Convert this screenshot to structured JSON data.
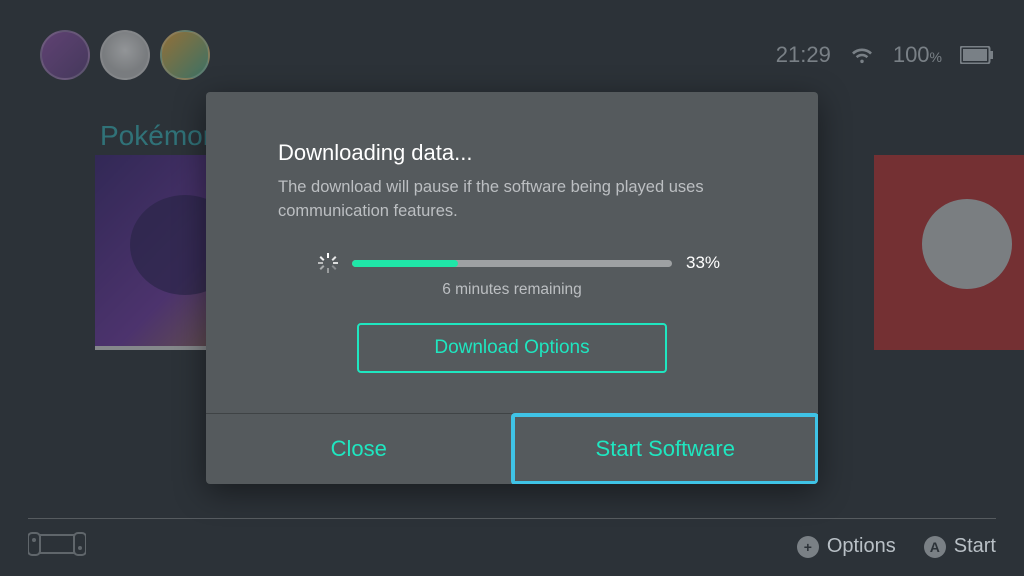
{
  "status": {
    "time": "21:29",
    "battery_percent": "100",
    "battery_unit": "%"
  },
  "selected_game_title": "Pokémon",
  "dialog": {
    "title": "Downloading data...",
    "subtitle": "The download will pause if the software being played uses communication features.",
    "progress_percent": 33,
    "progress_label": "33%",
    "remaining": "6 minutes remaining",
    "download_options": "Download Options",
    "close": "Close",
    "start": "Start Software"
  },
  "bottom": {
    "options": "Options",
    "start": "Start"
  },
  "colors": {
    "accent": "#1fe6c0",
    "highlight": "#3fc3e6",
    "progress_fill": "#1fe6a8"
  }
}
